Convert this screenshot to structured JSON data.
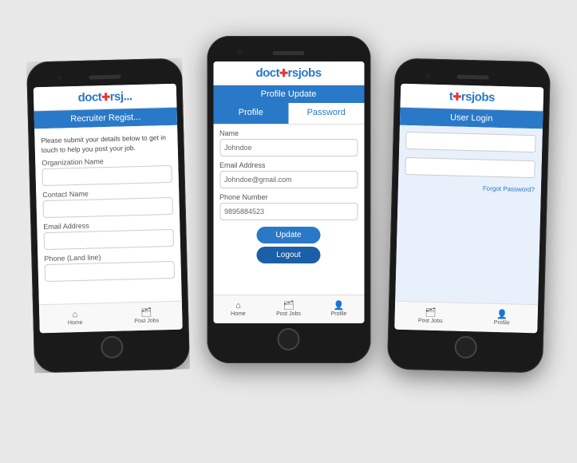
{
  "background": "#e8e8e8",
  "phones": {
    "left": {
      "logo": "doctorsj",
      "logo_colored": "o",
      "blue_bar": "Recruiter Regist...",
      "body_text": "Please submit your details below to get in touch to help you post your job.",
      "fields": [
        {
          "label": "Organization Name",
          "value": ""
        },
        {
          "label": "Contact Name",
          "value": ""
        },
        {
          "label": "Email Address",
          "value": ""
        },
        {
          "label": "Phone (Land line)",
          "value": ""
        }
      ],
      "tabbar": [
        {
          "icon": "⌂",
          "label": "Home"
        },
        {
          "icon": "💼",
          "label": "Post Jobs"
        }
      ]
    },
    "center": {
      "logo_part1": "doct",
      "logo_cross": "✚",
      "logo_part2": "rsjobs",
      "blue_bar": "Profile Update",
      "tab_profile": "Profile",
      "tab_password": "Password",
      "fields": [
        {
          "label": "Name",
          "placeholder": "Johndoe",
          "value": "Johndoe"
        },
        {
          "label": "Email Address",
          "placeholder": "Johndoe@gmail.com",
          "value": "Johndoe@gmail.com"
        },
        {
          "label": "Phone Number",
          "placeholder": "9895884523",
          "value": "9895884523"
        }
      ],
      "btn_update": "Update",
      "btn_logout": "Logout",
      "tabbar": [
        {
          "icon": "⌂",
          "label": "Home"
        },
        {
          "icon": "💼",
          "label": "Post Jobs"
        },
        {
          "icon": "👤",
          "label": "Profile"
        }
      ]
    },
    "right": {
      "logo_part1": "t",
      "logo_cross": "✚",
      "logo_part2": "rsjobs",
      "blue_bar": "User Login",
      "forgot_text": "?",
      "tabbar": [
        {
          "icon": "💼",
          "label": "Post Jobs"
        },
        {
          "icon": "👤",
          "label": "Profile"
        }
      ]
    }
  }
}
